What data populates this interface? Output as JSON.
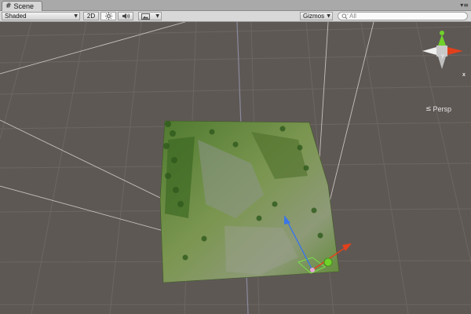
{
  "window": {
    "tab_title": "Scene",
    "tab_icon": "hash-icon",
    "tab_menu_icon": "tab-menu-icon"
  },
  "toolbar": {
    "shading_mode": "Shaded",
    "mode_2d_label": "2D",
    "lighting_icon": "sun-icon",
    "audio_icon": "speaker-icon",
    "effects_icon": "image-icon",
    "gizmos_label": "Gizmos",
    "search_placeholder": "All",
    "search_icon": "search-icon"
  },
  "viewport": {
    "projection_label": "Persp",
    "orientation_gizmo": {
      "y_label": "y",
      "x_label": "x"
    },
    "colors": {
      "background": "#5e5855",
      "grid": "#6c6663",
      "x_axis": "#e2401c",
      "y_axis": "#7ed321",
      "z_axis": "#3b76e8",
      "terrain": "#6f8f45"
    }
  }
}
